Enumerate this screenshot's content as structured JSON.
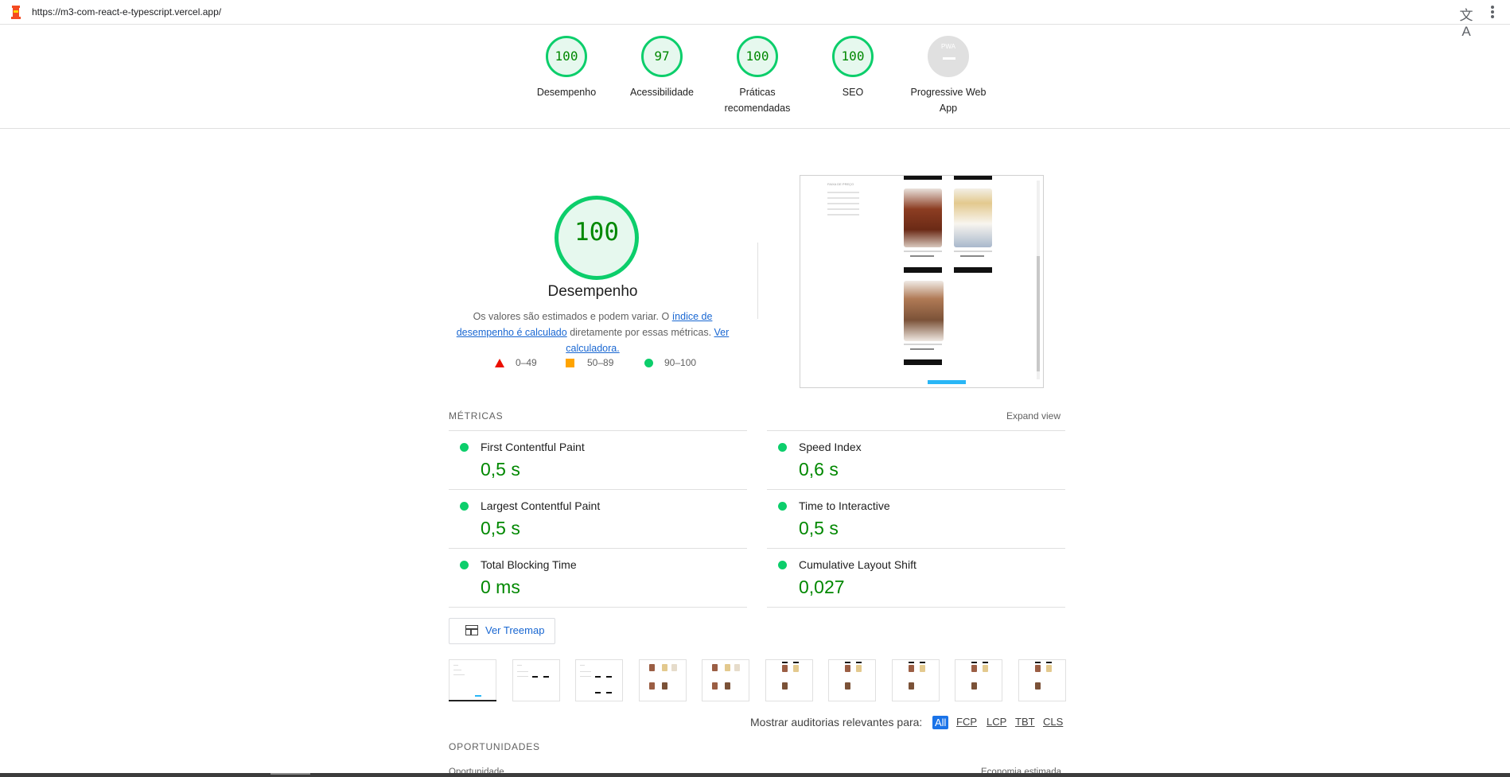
{
  "url": "https://m3-com-react-e-typescript.vercel.app/",
  "gauges": [
    {
      "score": "100",
      "label": "Desempenho"
    },
    {
      "score": "97",
      "label": "Acessibilidade"
    },
    {
      "score": "100",
      "label": "Práticas recomendadas"
    },
    {
      "score": "100",
      "label": "SEO"
    },
    {
      "score": "PWA",
      "label": "Progressive Web App"
    }
  ],
  "performance": {
    "score": "100",
    "title": "Desempenho",
    "desc_prefix": "Os valores são estimados e podem variar. O ",
    "desc_link1": "índice de desempenho é calculado",
    "desc_mid": " diretamente por essas métricas. ",
    "desc_link2": "Ver calculadora."
  },
  "legend": {
    "fail": "0–49",
    "average": "50–89",
    "pass": "90–100"
  },
  "metrics": {
    "title": "MÉTRICAS",
    "expand": "Expand view",
    "items": [
      {
        "name": "First Contentful Paint",
        "value": "0,5 s"
      },
      {
        "name": "Speed Index",
        "value": "0,6 s"
      },
      {
        "name": "Largest Contentful Paint",
        "value": "0,5 s"
      },
      {
        "name": "Time to Interactive",
        "value": "0,5 s"
      },
      {
        "name": "Total Blocking Time",
        "value": "0 ms"
      },
      {
        "name": "Cumulative Layout Shift",
        "value": "0,027"
      }
    ]
  },
  "treemap_label": "Ver Treemap",
  "filter": {
    "label": "Mostrar auditorias relevantes para:",
    "tags": [
      "All",
      "FCP",
      "LCP",
      "TBT",
      "CLS"
    ]
  },
  "opportunities": {
    "title": "OPORTUNIDADES",
    "col_left": "Oportunidade",
    "col_right": "Economia estimada"
  },
  "screenshot_text": {
    "filter_title": "FAIXA DE PREÇO"
  }
}
